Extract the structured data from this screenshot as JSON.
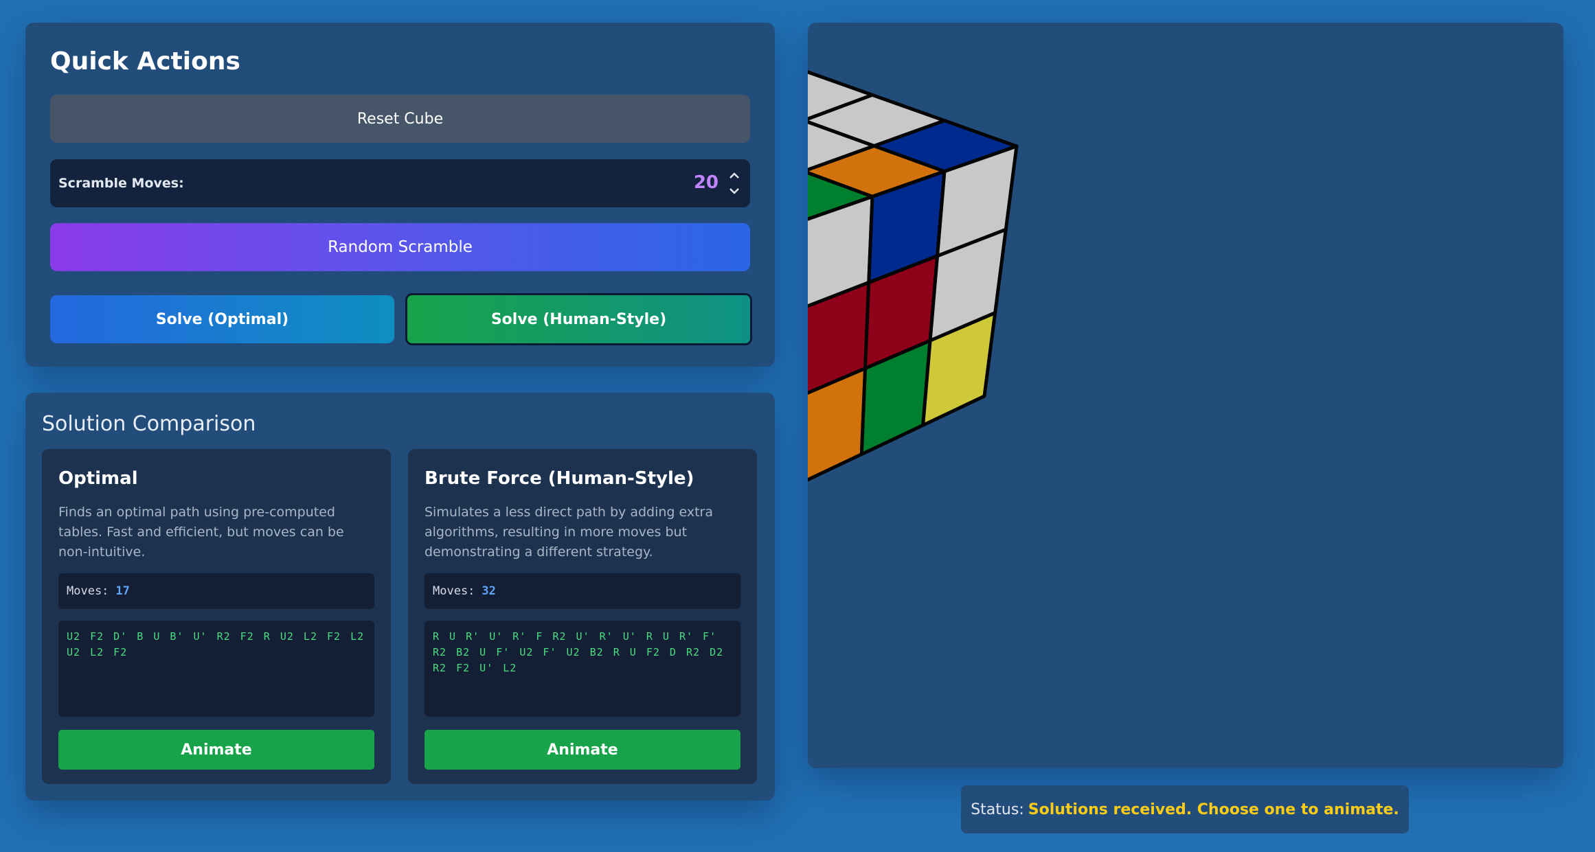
{
  "quick_actions": {
    "title": "Quick Actions",
    "reset_label": "Reset Cube",
    "scramble_label": "Scramble Moves:",
    "scramble_value": "20",
    "random_label": "Random Scramble",
    "solve_optimal_label": "Solve (Optimal)",
    "solve_human_label": "Solve (Human-Style)"
  },
  "solution": {
    "title": "Solution Comparison",
    "cards": [
      {
        "title": "Optimal",
        "description": "Finds an optimal path using pre-computed tables. Fast and efficient, but moves can be non-intuitive.",
        "moves_label": "Moves:",
        "moves_count": "17",
        "sequence": "U2 F2 D' B U B' U' R2 F2 R U2 L2 F2 L2 U2 L2 F2",
        "animate_label": "Animate"
      },
      {
        "title": "Brute Force (Human-Style)",
        "description": "Simulates a less direct path by adding extra algorithms, resulting in more moves but demonstrating a different strategy.",
        "moves_label": "Moves:",
        "moves_count": "32",
        "sequence": "R U R' U' R' F R2 U' R' U' R U R' F' R2 B2 U F' U2 F' U2 B2 R U F2 D R2 D2 R2 F2 U' L2",
        "animate_label": "Animate"
      }
    ]
  },
  "cube": {
    "colors": {
      "white": "#c8c8c8",
      "green": "#00802f",
      "blue": "#002a8e",
      "yellow": "#cfc93a",
      "orange": "#d2720c",
      "red": "#8f0019"
    }
  },
  "status": {
    "label": "Status:",
    "text": "Solutions received. Choose one to animate."
  },
  "colors": {
    "background": "#2170b4",
    "panel": "#224d7a",
    "accent_purple": "#c084fc",
    "accent_green": "#16a34a",
    "status_yellow": "#facc15"
  }
}
